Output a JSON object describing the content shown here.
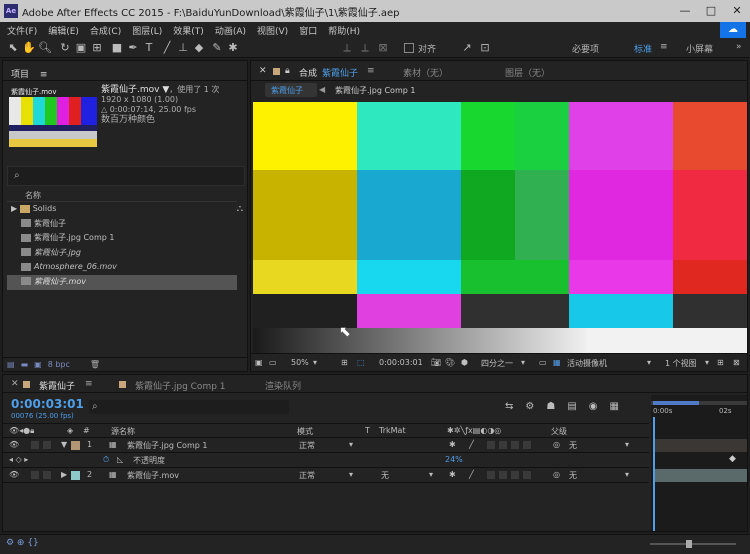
{
  "title_bar": {
    "app_icon": "Ae",
    "title": "Adobe After Effects CC 2015 - F:\\BaiduYunDownload\\紫霞仙子\\1\\紫霞仙子.aep",
    "minimize": "—",
    "maximize": "□",
    "close": "✕"
  },
  "menu": [
    "文件(F)",
    "编辑(E)",
    "合成(C)",
    "图层(L)",
    "效果(T)",
    "动画(A)",
    "视图(V)",
    "窗口",
    "帮助(H)"
  ],
  "toolbar": {
    "align_label": "对齐",
    "workspaces": [
      "必要项",
      "标准",
      "小屏幕"
    ],
    "active_workspace": "标准",
    "menu_icon": "≡",
    "expand_icon": "»"
  },
  "project_panel": {
    "tab": "项目",
    "tab_menu": "≡",
    "thumb_label": "紫霞仙子.mov",
    "selected_name": "紫霞仙子.mov ▼",
    "used_info": "，使用了 1 次",
    "resolution": "1920 x 1080 (1.00)",
    "duration": "△ 0:00:07:14, 25.00 fps",
    "color_info": "数百万种颜色",
    "search_icon_glyph": "⌕",
    "column_name": "名称",
    "items": [
      {
        "name": "Solids",
        "type": "folder",
        "italic": false,
        "selected": false
      },
      {
        "name": "紫霞仙子",
        "type": "comp",
        "italic": false,
        "selected": false
      },
      {
        "name": "紫霞仙子.jpg Comp 1",
        "type": "comp",
        "italic": false,
        "selected": false
      },
      {
        "name": "紫霞仙子.jpg",
        "type": "footage",
        "italic": true,
        "selected": false
      },
      {
        "name": "Atmosphere_06.mov",
        "type": "footage",
        "italic": true,
        "selected": false
      },
      {
        "name": "紫霞仙子.mov",
        "type": "footage",
        "italic": true,
        "selected": true
      }
    ],
    "bpc": "8 bpc"
  },
  "comp_panel": {
    "tab_prefix": "合成",
    "tab_comp_name": "紫霞仙子",
    "tab_menu": "≡",
    "other_tabs": [
      "素材（无）",
      "图层（无）"
    ],
    "flow": [
      "紫霞仙子",
      "紫霞仙子.jpg Comp 1"
    ],
    "footer": {
      "zoom": "50%",
      "time": "0:00:03:01",
      "resolution": "四分之一",
      "camera": "活动摄像机",
      "views": "1 个视图"
    }
  },
  "bars_image": {
    "top_colors": [
      "#fff200",
      "#2ee8c0",
      "#18d830",
      "#1ad040",
      "#e040e8",
      "#e84a30"
    ],
    "mid_colors": [
      "#c8b400",
      "#18a8d0",
      "#10a820",
      "#30b050",
      "#e028e0",
      "#f02a40"
    ],
    "low_colors": [
      "#e8d820",
      "#18d8f0",
      "#18c030",
      "#18c030",
      "#e838e8",
      "#e02820"
    ],
    "bottom_row": [
      "#202020",
      "#e040e0",
      "#303030",
      "#303030",
      "#18c8e8",
      "#303030"
    ]
  },
  "timeline": {
    "tabs": [
      "紫霞仙子",
      "紫霞仙子.jpg Comp 1",
      "渲染队列"
    ],
    "tab_menu": "≡",
    "timecode": "0:00:03:01",
    "frames": "00076 (25.00 fps)",
    "search_icon_glyph": "⌕",
    "columns": {
      "index": "#",
      "source": "源名称",
      "mode": "模式",
      "t": "T",
      "trkmat": "TrkMat",
      "parent": "父级"
    },
    "layers": [
      {
        "index": "1",
        "name": "紫霞仙子.jpg Comp 1",
        "mode": "正常",
        "trkmat": "",
        "parent": "无",
        "label_color": "#b39774"
      },
      {
        "index": "2",
        "name": "紫霞仙子.mov",
        "mode": "正常",
        "trkmat": "无",
        "parent": "无",
        "label_color": "#8ec9c9"
      }
    ],
    "property": {
      "name": "不透明度",
      "value": "24%"
    },
    "ruler": {
      "start": "0:00s",
      "end": "02s"
    }
  }
}
